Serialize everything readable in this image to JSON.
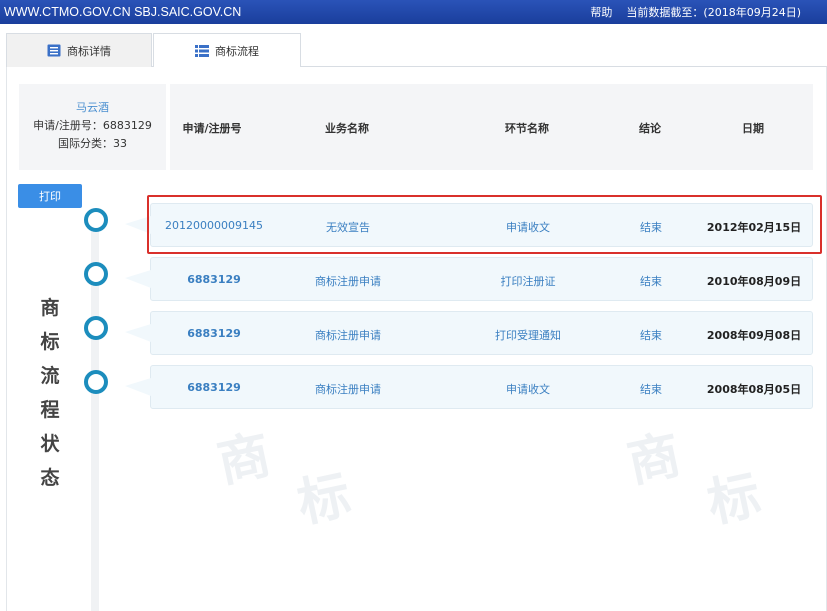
{
  "topbar": {
    "site_text": "WWW.CTMO.GOV.CN SBJ.SAIC.GOV.CN",
    "help_label": "帮助",
    "date_info": "当前数据截至：(2018年09月24日)"
  },
  "tabs": [
    {
      "label": "商标详情",
      "icon": "document-list-icon"
    },
    {
      "label": "商标流程",
      "icon": "list-icon"
    }
  ],
  "info": {
    "name": "马云酒",
    "reg_no": "申请/注册号：6883129",
    "class": "国际分类：33"
  },
  "table": {
    "headers": [
      "申请/注册号",
      "业务名称",
      "环节名称",
      "结论",
      "日期"
    ],
    "rows": [
      {
        "number": "20120000009145",
        "business": "无效宣告",
        "step": "申请收文",
        "result": "结束",
        "date": "2012年02月15日"
      },
      {
        "number": "6883129",
        "business": "商标注册申请",
        "step": "打印注册证",
        "result": "结束",
        "date": "2010年08月09日"
      },
      {
        "number": "6883129",
        "business": "商标注册申请",
        "step": "打印受理通知",
        "result": "结束",
        "date": "2008年09月08日"
      },
      {
        "number": "6883129",
        "business": "商标注册申请",
        "step": "申请收文",
        "result": "结束",
        "date": "2008年08月05日"
      }
    ]
  },
  "print_label": "打印",
  "side_title": [
    "商",
    "标",
    "流",
    "程",
    "状",
    "态"
  ],
  "colors": {
    "topbar": "#1a3e9c",
    "accent": "#3a8ee6",
    "node": "#1c8dbd",
    "highlight": "#d9302b"
  }
}
